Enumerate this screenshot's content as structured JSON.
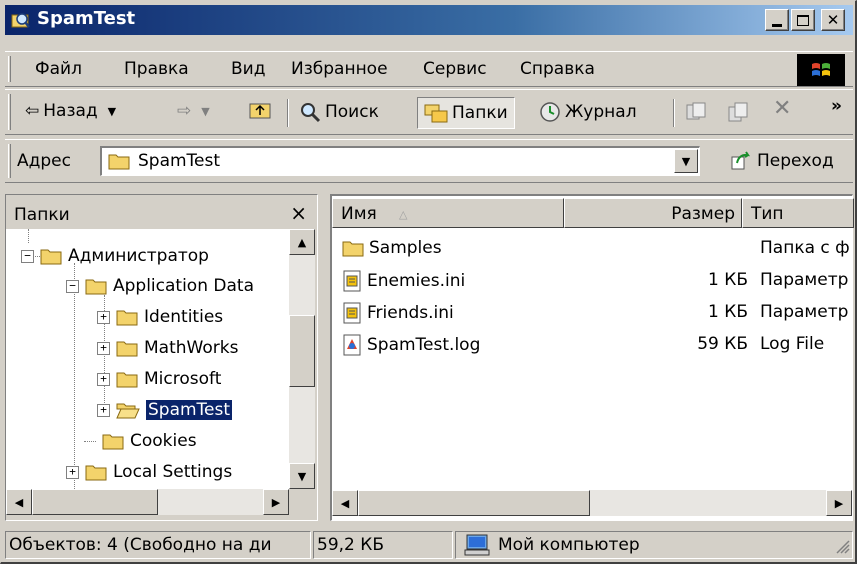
{
  "window": {
    "title": "SpamTest"
  },
  "menu": {
    "items": [
      {
        "label": "Файл"
      },
      {
        "label": "Правка"
      },
      {
        "label": "Вид"
      },
      {
        "label": "Избранное"
      },
      {
        "label": "Сервис"
      },
      {
        "label": "Справка"
      }
    ]
  },
  "toolbar": {
    "back_label": "Назад",
    "search_label": "Поиск",
    "folders_label": "Папки",
    "history_label": "Журнал"
  },
  "address": {
    "label": "Адрес",
    "value": "SpamTest",
    "go_label": "Переход"
  },
  "folders_pane": {
    "title": "Папки",
    "close_glyph": "×",
    "tree": [
      {
        "label": "Администратор",
        "expander": "−"
      },
      {
        "label": "Application Data",
        "expander": "−"
      },
      {
        "label": "Identities",
        "expander": "+"
      },
      {
        "label": "MathWorks",
        "expander": "+"
      },
      {
        "label": "Microsoft",
        "expander": "+"
      },
      {
        "label": "SpamTest",
        "expander": "+",
        "selected": true
      },
      {
        "label": "Cookies",
        "expander": ""
      },
      {
        "label": "Local Settings",
        "expander": "+"
      }
    ]
  },
  "file_list": {
    "columns": {
      "name": "Имя",
      "size": "Размер",
      "type": "Тип"
    },
    "rows": [
      {
        "name": "Samples",
        "size": "",
        "type": "Папка с ф",
        "icon": "folder-icon"
      },
      {
        "name": "Enemies.ini",
        "size": "1 КБ",
        "type": "Параметр",
        "icon": "ini-file-icon"
      },
      {
        "name": "Friends.ini",
        "size": "1 КБ",
        "type": "Параметр",
        "icon": "ini-file-icon"
      },
      {
        "name": "SpamTest.log",
        "size": "59 КБ",
        "type": "Log File",
        "icon": "log-file-icon"
      }
    ]
  },
  "status": {
    "objects": "Объектов: 4 (Свободно на ди",
    "size": "59,2 КБ",
    "zone": "Мой компьютер"
  },
  "colors": {
    "title_active": "#0a246a",
    "selection": "#0a246a",
    "face": "#d4d0c8"
  }
}
